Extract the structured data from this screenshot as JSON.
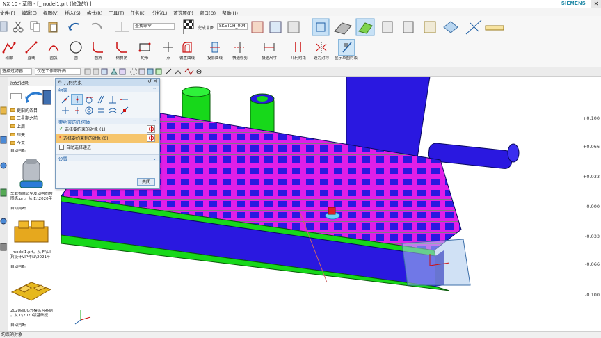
{
  "window": {
    "title": "NX 10 - 草图 - [_model1.prt  (修改的) ]",
    "brand": "SIEMENS",
    "close": "✕"
  },
  "menu": [
    "文件(F)",
    "编辑(E)",
    "视图(V)",
    "插入(S)",
    "格式(R)",
    "工具(T)",
    "任务(K)",
    "分析(L)",
    "首选项(P)",
    "窗口(O)",
    "帮助(H)"
  ],
  "toolbar1": {
    "command_search": "查找命令",
    "finish_sketch": "完成草图",
    "sketch_name": "SKETCH_004"
  },
  "toolbar2": {
    "tools": [
      "轮廓",
      "直线",
      "圆弧",
      "圆",
      "圆角",
      "倒斜角",
      "矩形",
      "点",
      "偏置曲线",
      "投影曲线",
      "快速修剪",
      "快速尺寸",
      "几何约束",
      "设为对称",
      "显示草图约束"
    ]
  },
  "filterbar": {
    "selection_filter": "选择过滤器",
    "scope": "仅在工作部件内"
  },
  "history": {
    "header": "历史记录",
    "folders": [
      "更旧的条目",
      "三星期之前",
      "上周",
      "昨天",
      "今天"
    ],
    "auto_label": "自动判断",
    "items": [
      {
        "caption": "车载香薰造型及动构图构图练.prt。从 E:\\2020年"
      },
      {
        "caption": "_model1.prt。从 F:\\UI具设计VIP作业\\2021年"
      },
      {
        "caption": "2020版UG分模练习案例 。从 I:\\2020版基础班"
      }
    ]
  },
  "dialog": {
    "title": "几何约束",
    "section_constraint": "约束",
    "section_geometry": "要约束的几何体",
    "row_select_object": "选择要约束的对象 (1)",
    "row_select_target": "选择要约束到的对象 (0)",
    "auto_select": "自动选择递进",
    "section_settings": "设置",
    "close_label": "关闭"
  },
  "axis_values": [
    "+0.100",
    "+0.066",
    "+0.033",
    "0.000",
    "-0.033",
    "-0.066",
    "-0.100"
  ],
  "status": "约束的对象",
  "colors": {
    "part_magenta": "#e01fe8",
    "part_blue": "#2a18e0",
    "part_green": "#17d81a",
    "dialog_highlight": "#f6c56c"
  }
}
